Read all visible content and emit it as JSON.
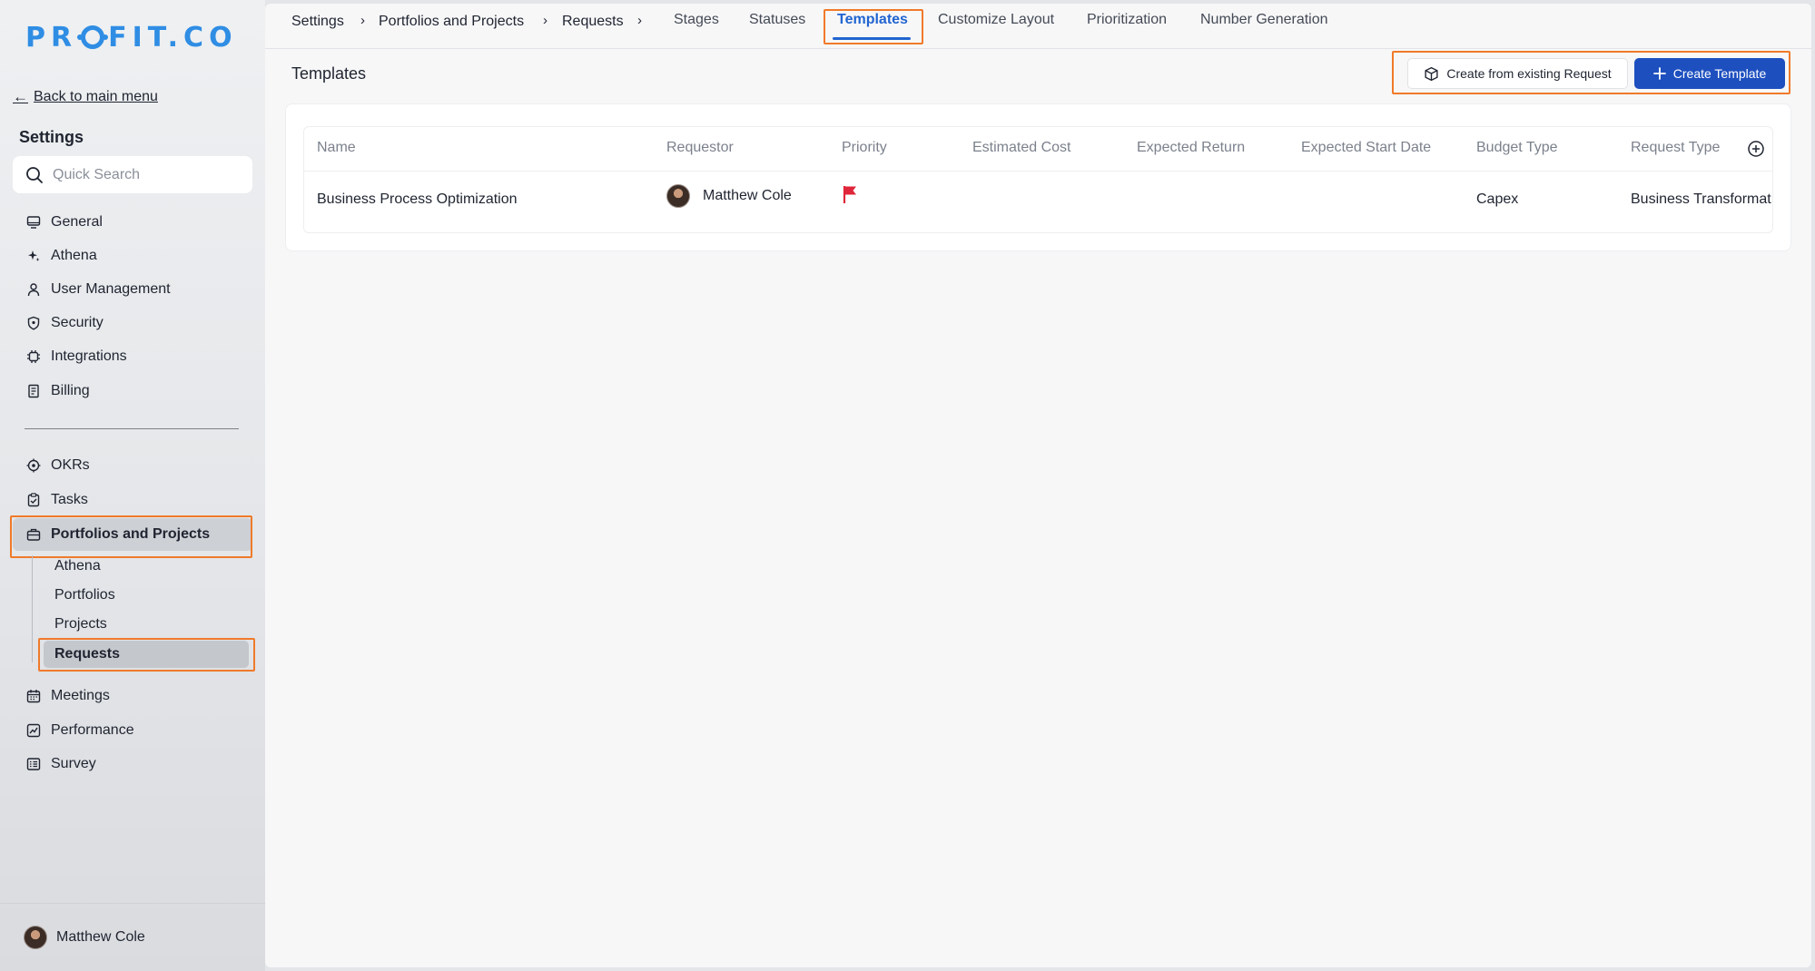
{
  "app": {
    "logo": "PROFIT.CO"
  },
  "sidebar": {
    "back_label": "Back to main menu",
    "title": "Settings",
    "search_placeholder": "Quick Search",
    "items_top": [
      {
        "label": "General",
        "icon": "monitor-icon"
      },
      {
        "label": "Athena",
        "icon": "sparkle-icon"
      },
      {
        "label": "User Management",
        "icon": "user-icon"
      },
      {
        "label": "Security",
        "icon": "shield-icon"
      },
      {
        "label": "Integrations",
        "icon": "chip-icon"
      },
      {
        "label": "Billing",
        "icon": "receipt-icon"
      }
    ],
    "items_bottom": [
      {
        "label": "OKRs",
        "icon": "target-icon"
      },
      {
        "label": "Tasks",
        "icon": "clipboard-check-icon"
      },
      {
        "label": "Portfolios and Projects",
        "icon": "briefcase-icon",
        "active": true
      },
      {
        "label": "Meetings",
        "icon": "calendar-icon"
      },
      {
        "label": "Performance",
        "icon": "chart-line-icon"
      },
      {
        "label": "Survey",
        "icon": "survey-list-icon"
      }
    ],
    "sub_items": [
      {
        "label": "Athena"
      },
      {
        "label": "Portfolios"
      },
      {
        "label": "Projects"
      },
      {
        "label": "Requests",
        "active": true
      }
    ],
    "user_name": "Matthew Cole"
  },
  "header": {
    "breadcrumbs": [
      "Settings",
      "Portfolios and Projects",
      "Requests"
    ],
    "tabs": [
      {
        "label": "Stages"
      },
      {
        "label": "Statuses"
      },
      {
        "label": "Templates",
        "active": true
      },
      {
        "label": "Customize Layout"
      },
      {
        "label": "Prioritization"
      },
      {
        "label": "Number Generation"
      }
    ]
  },
  "main": {
    "title": "Templates",
    "btn_existing": "Create from existing Request",
    "btn_create": "Create Template",
    "table": {
      "columns": [
        "Name",
        "Requestor",
        "Priority",
        "Estimated Cost",
        "Expected Return",
        "Expected Start Date",
        "Budget Type",
        "Request Type"
      ],
      "rows": [
        {
          "name": "Business Process Optimization",
          "requestor": "Matthew Cole",
          "priority": "flag-red",
          "estimated_cost": "",
          "expected_return": "",
          "expected_start_date": "",
          "budget_type": "Capex",
          "request_type": "Business Transformat"
        }
      ]
    }
  },
  "colors": {
    "accent": "#2164d0",
    "primary_button": "#1d4fbf",
    "logo": "#2f8de4",
    "highlight": "#f07a2a",
    "priority_flag": "#e0263a"
  }
}
